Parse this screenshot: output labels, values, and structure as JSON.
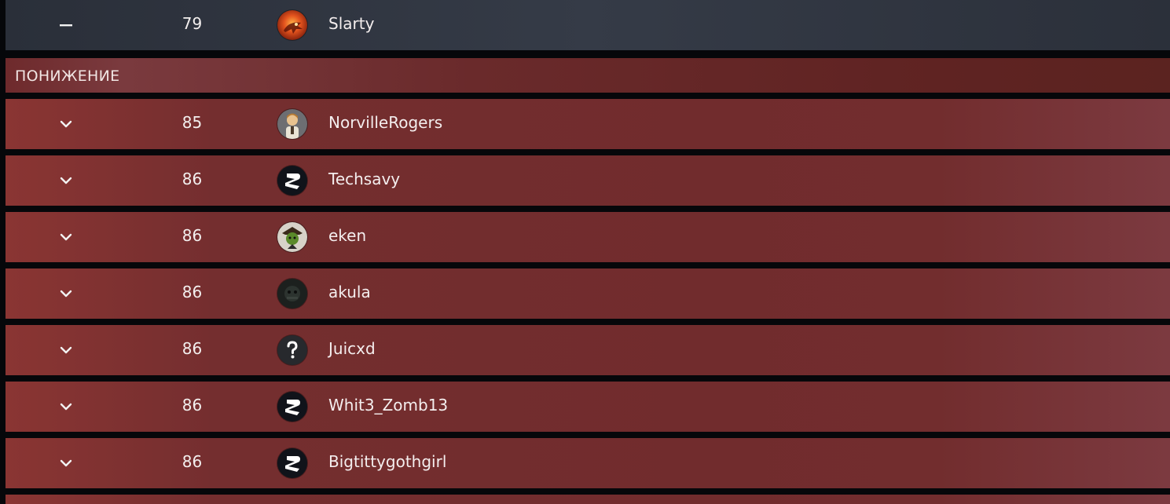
{
  "top_row": {
    "indicator": "minus-icon",
    "rank": "79",
    "name": "Slarty",
    "avatar": "dragon-avatar"
  },
  "section": {
    "title": "ПОНИЖЕНИЕ"
  },
  "rows": [
    {
      "rank": "85",
      "name": "NorvilleRogers",
      "avatar": "character-avatar"
    },
    {
      "rank": "86",
      "name": "Techsavy",
      "avatar": "logo-avatar"
    },
    {
      "rank": "86",
      "name": "eken",
      "avatar": "goblin-avatar"
    },
    {
      "rank": "86",
      "name": "akula",
      "avatar": "dark-avatar"
    },
    {
      "rank": "86",
      "name": "Juicxd",
      "avatar": "question-avatar"
    },
    {
      "rank": "86",
      "name": "Whit3_Zomb13",
      "avatar": "logo-avatar"
    },
    {
      "rank": "86",
      "name": "Bigtittygothgirl",
      "avatar": "logo-avatar"
    }
  ],
  "colors": {
    "demote_row": "#742e2f",
    "demote_header": "#5f2322",
    "neutral_row": "#353b47",
    "text": "#f4eeee"
  }
}
